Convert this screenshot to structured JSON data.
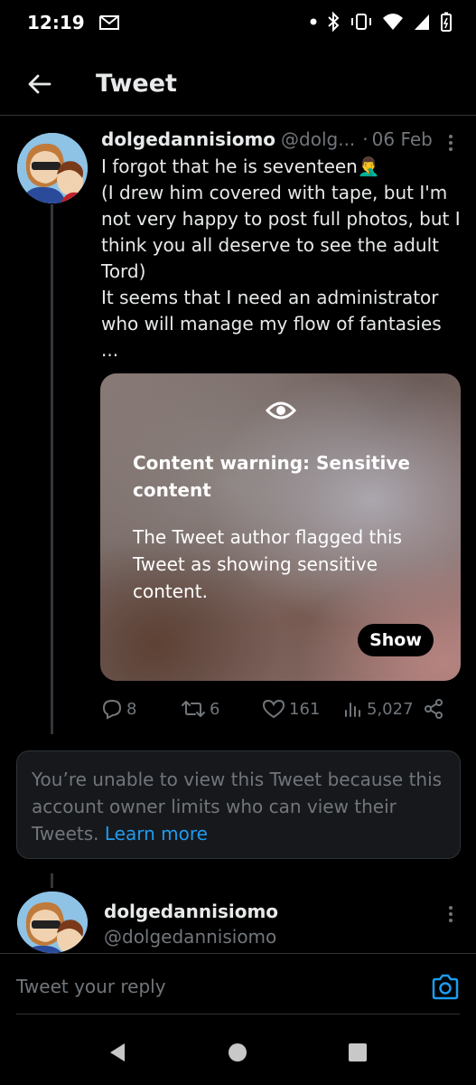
{
  "status_bar": {
    "time": "12:19"
  },
  "header": {
    "title": "Tweet"
  },
  "tweet": {
    "name": "dolgedannisiomo",
    "handle": "@dolg...",
    "separator": "·",
    "date": "06 Feb",
    "text": "I forgot that he is seventeen🤦‍♂️\n(I drew him covered with tape, but I'm not very happy to post full photos, but I think you all deserve to see the adult Tord)\nIt seems that I need an administrator who will manage my flow of fantasies ...",
    "media": {
      "warning_title": "Content warning: Sensitive content",
      "warning_body": "The Tweet author flagged this Tweet as showing sensitive content.",
      "show_label": "Show"
    },
    "actions": {
      "replies": "8",
      "retweets": "6",
      "likes": "161",
      "views": "5,027"
    }
  },
  "notice": {
    "text": "You’re unable to view this Tweet because this account owner limits who can view their Tweets. ",
    "link": "Learn more"
  },
  "reply_to": {
    "name": "dolgedannisiomo",
    "handle": "@dolgedannisiomo"
  },
  "reply_bar": {
    "placeholder": "Tweet your reply"
  },
  "colors": {
    "background": "#000000",
    "accent": "#1d9bf0",
    "secondary_text": "#71767b",
    "border": "#2f3336"
  },
  "icons": [
    "arrow-left-icon",
    "more-vertical-icon",
    "eye-icon",
    "reply-icon",
    "retweet-icon",
    "heart-icon",
    "views-icon",
    "share-icon",
    "camera-icon",
    "nav-back-icon",
    "nav-home-icon",
    "nav-recents-icon"
  ]
}
